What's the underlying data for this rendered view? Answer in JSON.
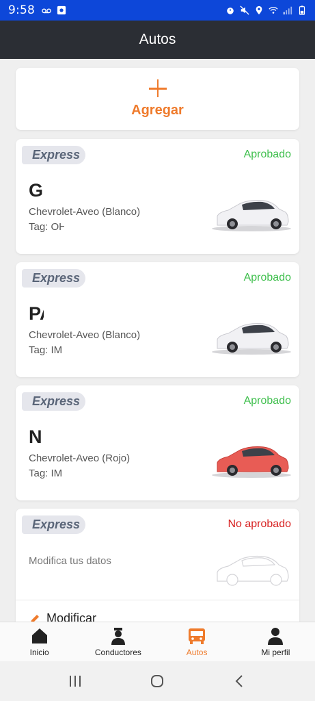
{
  "status_bar": {
    "time": "9:58"
  },
  "app_bar": {
    "title": "Autos"
  },
  "add_card": {
    "label": "Agregar"
  },
  "cars": [
    {
      "badge": "Express",
      "status": "Aprobado",
      "plate": "G",
      "model": "Chevrolet-Aveo (Blanco)",
      "tag": "Tag: OH",
      "color": "#f1f1f4"
    },
    {
      "badge": "Express",
      "status": "Aprobado",
      "plate": "PA",
      "model": "Chevrolet-Aveo (Blanco)",
      "tag": "Tag: IM",
      "color": "#f1f1f4"
    },
    {
      "badge": "Express",
      "status": "Aprobado",
      "plate": "N",
      "model": "Chevrolet-Aveo (Rojo)",
      "tag": "Tag: IM",
      "color": "#e85c55"
    }
  ],
  "pending_card": {
    "badge": "Express",
    "status": "No aprobado",
    "hint": "Modifica tus datos",
    "edit_label": "Modificar"
  },
  "bottom_nav": [
    {
      "label": "Inicio",
      "icon": "home-icon"
    },
    {
      "label": "Conductores",
      "icon": "driver-icon"
    },
    {
      "label": "Autos",
      "icon": "bus-icon",
      "active": true
    },
    {
      "label": "Mi perfil",
      "icon": "person-icon"
    }
  ],
  "colors": {
    "accent": "#ef7b2c",
    "approved": "#3fbf4d",
    "rejected": "#d71f1f",
    "app_bar": "#2b2e34",
    "status_bar": "#0d47d9"
  }
}
